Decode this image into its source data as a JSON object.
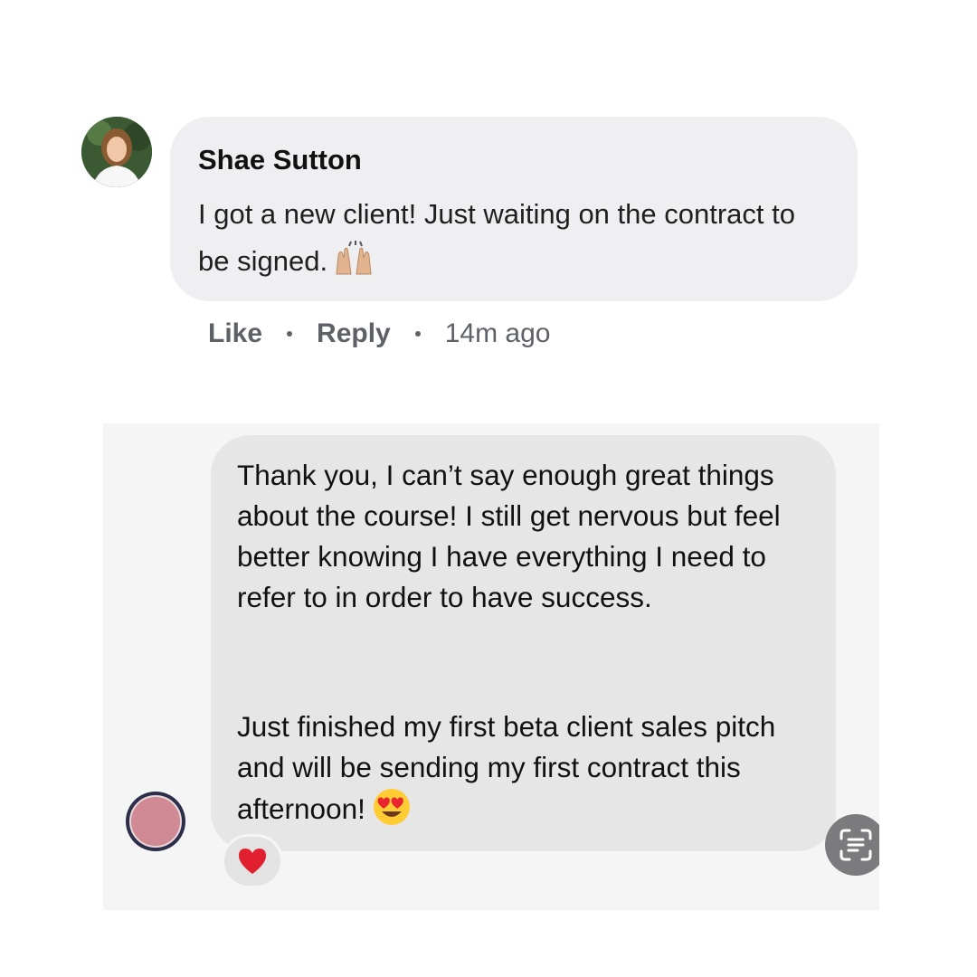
{
  "comment": {
    "author": "Shae Sutton",
    "text": "I got a new client! Just waiting on the contract to be signed.",
    "actions": {
      "like_label": "Like",
      "reply_label": "Reply",
      "timestamp": "14m ago"
    },
    "emoji": "raising-hands-emoji"
  },
  "message": {
    "paragraphs": [
      "Thank you, I can’t say enough great things about the course! I still get nervous but feel better knowing I have everything I need to refer to in order to have success.",
      "Just finished my first beta client sales pitch and will be sending my first contract this afternoon!"
    ],
    "emoji": "heart-eyes-emoji",
    "reaction": "heart-icon"
  },
  "colors": {
    "comment_bubble": "#efeff1",
    "message_bubble": "#e6e6e7",
    "panel_background": "#f5f5f5",
    "action_text": "#5f6168",
    "heart": "#e0202e"
  },
  "icons": {
    "scan": "text-scan-icon"
  }
}
